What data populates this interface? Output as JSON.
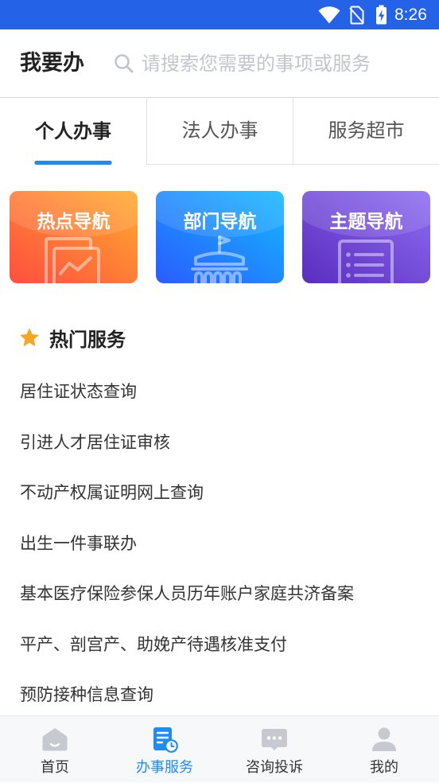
{
  "status_bar": {
    "time": "8:26",
    "icons": [
      "wifi-icon",
      "no-sim-icon",
      "battery-charging-icon"
    ]
  },
  "header": {
    "title": "我要办",
    "search": {
      "icon": "search-icon",
      "placeholder": "请搜索您需要的事项或服务"
    }
  },
  "tabs": [
    {
      "label": "个人办事",
      "active": true
    },
    {
      "label": "法人办事",
      "active": false
    },
    {
      "label": "服务超市",
      "active": false
    }
  ],
  "nav_cards": [
    {
      "label": "热点导航",
      "icon": "chart-document-icon",
      "colors": [
        "#ffab2e",
        "#ff4e3f"
      ]
    },
    {
      "label": "部门导航",
      "icon": "building-icon",
      "colors": [
        "#14b8ff",
        "#2a5cff"
      ]
    },
    {
      "label": "主题导航",
      "icon": "list-document-icon",
      "colors": [
        "#8e6df3",
        "#5a2dbf"
      ]
    }
  ],
  "hot_services": {
    "title": "热门服务",
    "icon": "star-icon",
    "items": [
      "居住证状态查询",
      "引进人才居住证审核",
      "不动产权属证明网上查询",
      "出生一件事联办",
      "基本医疗保险参保人员历年账户家庭共济备案",
      "平产、剖宫产、助娩产待遇核准支付",
      "预防接种信息查询"
    ]
  },
  "bottom_nav": {
    "items": [
      {
        "label": "首页",
        "icon": "home-icon",
        "active": false
      },
      {
        "label": "办事服务",
        "icon": "service-document-icon",
        "active": true
      },
      {
        "label": "咨询投诉",
        "icon": "chat-icon",
        "active": false
      },
      {
        "label": "我的",
        "icon": "user-icon",
        "active": false
      }
    ]
  },
  "theme": {
    "status_bar": "#2462e8",
    "accent": "#1f8cf2",
    "star": "#f5a623",
    "inactive_icon": "#c6cad0",
    "text": "#333333",
    "placeholder": "#c2c6cc"
  }
}
